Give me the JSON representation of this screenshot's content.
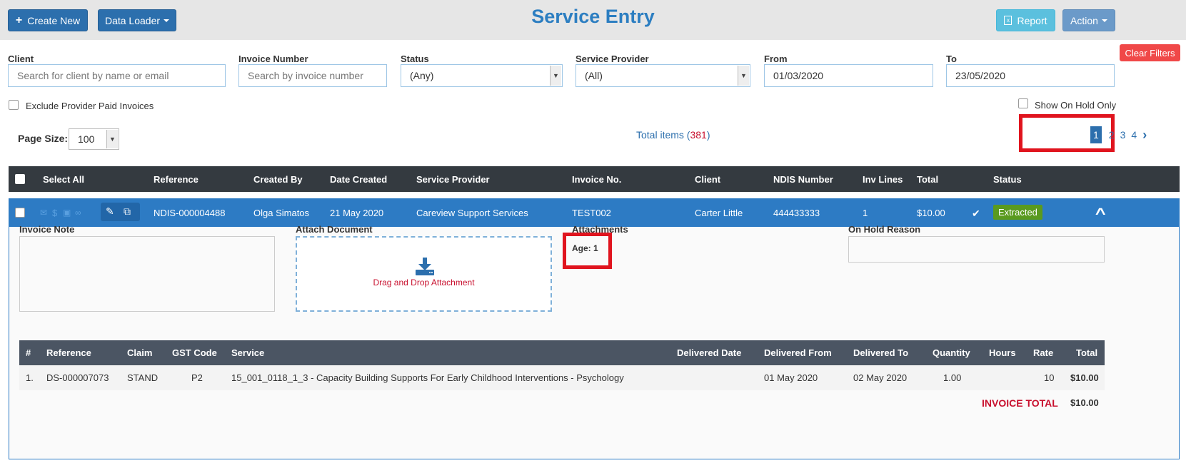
{
  "header": {
    "create_new": "Create New",
    "data_loader": "Data Loader",
    "title": "Service Entry",
    "report": "Report",
    "action": "Action"
  },
  "filters": {
    "client_label": "Client",
    "client_placeholder": "Search for client by name or email",
    "invoice_label": "Invoice Number",
    "invoice_placeholder": "Search by invoice number",
    "status_label": "Status",
    "status_value": "(Any)",
    "provider_label": "Service Provider",
    "provider_value": "(All)",
    "from_label": "From",
    "from_value": "01/03/2020",
    "to_label": "To",
    "to_value": "23/05/2020",
    "clear_filters": "Clear Filters",
    "exclude_label": "Exclude Provider Paid Invoices",
    "on_hold_label": "Show On Hold Only"
  },
  "paging": {
    "page_size_label": "Page Size:",
    "page_size_value": "100",
    "total_prefix": "Total items (",
    "total_count": "381",
    "total_suffix": ")",
    "pages": [
      "1",
      "2",
      "3",
      "4"
    ],
    "next": "›"
  },
  "table": {
    "headers": {
      "select_all": "Select All",
      "reference": "Reference",
      "created_by": "Created By",
      "date_created": "Date Created",
      "service_provider": "Service Provider",
      "invoice_no": "Invoice No.",
      "client": "Client",
      "ndis_number": "NDIS Number",
      "inv_lines": "Inv Lines",
      "total": "Total",
      "status": "Status"
    },
    "row": {
      "reference": "NDIS-000004488",
      "created_by": "Olga Simatos",
      "date_created": "21 May 2020",
      "service_provider": "Careview Support Services",
      "invoice_no": "TEST002",
      "client": "Carter Little",
      "ndis_number": "444433333",
      "inv_lines": "1",
      "total": "$10.00",
      "status": "Extracted"
    }
  },
  "detail": {
    "invoice_note_label": "Invoice Note",
    "attach_label": "Attach Document",
    "drag_drop": "Drag and Drop Attachment",
    "attachments_label": "Attachments",
    "age": "Age: 1",
    "on_hold_label": "On Hold Reason",
    "items": {
      "headers": {
        "num": "#",
        "reference": "Reference",
        "claim": "Claim",
        "gst": "GST Code",
        "service": "Service",
        "delivered_date": "Delivered Date",
        "delivered_from": "Delivered From",
        "delivered_to": "Delivered To",
        "quantity": "Quantity",
        "hours": "Hours",
        "rate": "Rate",
        "total": "Total"
      },
      "row": {
        "num": "1.",
        "reference": "DS-000007073",
        "claim": "STAND",
        "gst": "P2",
        "service": "15_001_0118_1_3 - Capacity Building Supports For Early Childhood Interventions - Psychology",
        "delivered_from": "01 May 2020",
        "delivered_to": "02 May 2020",
        "quantity": "1.00",
        "rate": "10",
        "total": "$10.00"
      },
      "invoice_total_label": "INVOICE TOTAL",
      "invoice_total": "$10.00"
    }
  },
  "colors": {
    "primary": "#2c6fad",
    "title": "#2c7ec1",
    "header_dark": "#343a40",
    "selected_row": "#2d7bc4",
    "extracted": "#5a9a1f",
    "highlight": "#e0141e",
    "total_red": "#c8102e"
  }
}
